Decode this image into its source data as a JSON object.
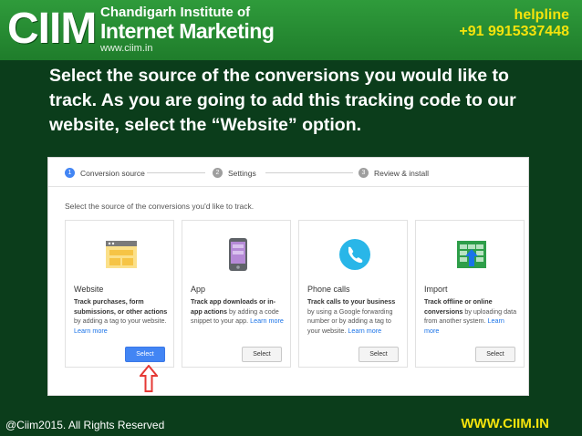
{
  "header": {
    "logo": "CIIM",
    "org_line1": "Chandigarh Institute of",
    "org_line2": "Internet Marketing",
    "org_url": "www.ciim.in",
    "helpline_label": "helpline",
    "helpline_phone": "+91 9915337448"
  },
  "instruction": "Select the source of the conversions you would like to track. As you are going to add this tracking code to our website, select the “Website” option.",
  "steps": [
    {
      "num": "1",
      "label": "Conversion source"
    },
    {
      "num": "2",
      "label": "Settings"
    },
    {
      "num": "3",
      "label": "Review & install"
    }
  ],
  "prompt": "Select the source of the conversions you'd like to track.",
  "cards": [
    {
      "title": "Website",
      "desc_bold": "Track purchases, form submissions, or other actions",
      "desc_rest": " by adding a tag to your website. ",
      "learn_more": "Learn more",
      "button": "Select",
      "icon": "website-icon"
    },
    {
      "title": "App",
      "desc_bold": "Track app downloads or in-app actions",
      "desc_rest": " by adding a code snippet to your app. ",
      "learn_more": "Learn more",
      "button": "Select",
      "icon": "phone-app-icon"
    },
    {
      "title": "Phone calls",
      "desc_bold": "Track calls to your business",
      "desc_rest": " by using a Google forwarding number or by adding a tag to your website. ",
      "learn_more": "Learn more",
      "button": "Select",
      "icon": "phone-call-icon"
    },
    {
      "title": "Import",
      "desc_bold": "Track offline or online conversions",
      "desc_rest": " by uploading data from another system. ",
      "learn_more": "Learn more",
      "button": "Select",
      "icon": "import-icon"
    }
  ],
  "footer": {
    "copyright": "@Ciim2015. All Rights Reserved",
    "site": "WWW.CIIM.IN"
  },
  "colors": {
    "background": "#0b3d1b",
    "header_green": "#2f9b3b",
    "accent_yellow": "#f4e30c",
    "primary_blue": "#4285f4",
    "arrow_red": "#e53935"
  }
}
